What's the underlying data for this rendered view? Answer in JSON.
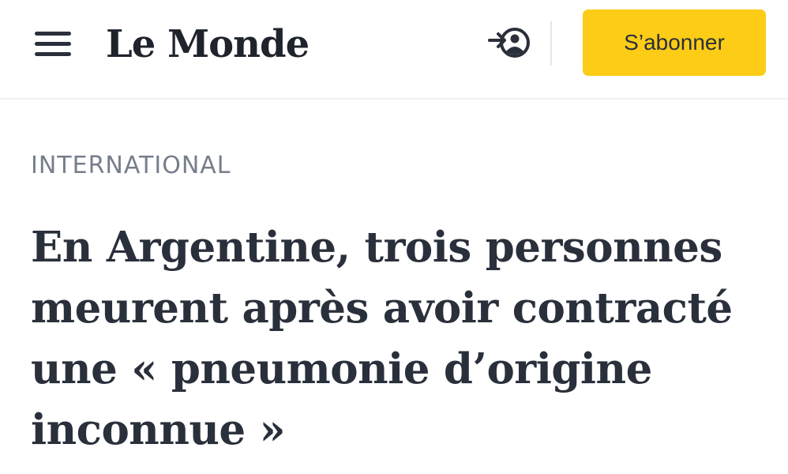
{
  "header": {
    "logo_text": "Le Monde",
    "menu_icon": "hamburger-menu-icon",
    "login_icon": "login-user-icon",
    "subscribe_label": "S’abonner",
    "colors": {
      "subscribe_bg": "#fccc16",
      "text": "#2a303b"
    }
  },
  "article": {
    "section": "INTERNATIONAL",
    "headline": "En Argentine, trois personnes meurent après avoir contracté une « pneumonie d’origine inconnue »",
    "colors": {
      "section": "#767e8b",
      "headline": "#2a303b"
    }
  }
}
